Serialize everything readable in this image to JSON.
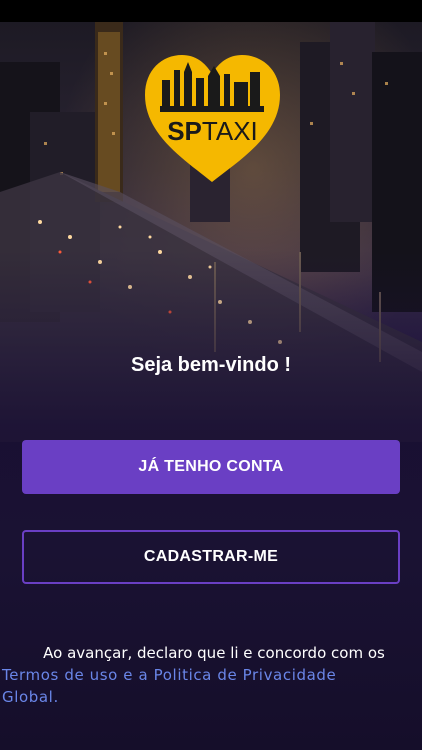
{
  "logo": {
    "text_sp": "SP",
    "text_taxi": "TAXI"
  },
  "welcome": "Seja bem-vindo !",
  "buttons": {
    "login": "JÁ TENHO CONTA",
    "signup": "CADASTRAR-ME"
  },
  "consent": {
    "text": "Ao avançar, declaro que li e concordo com os",
    "link_line1": "Termos de uso e a Politica de Privacidade",
    "link_line2": "Global."
  },
  "colors": {
    "accent": "#6a3fc4",
    "link": "#6a86e8",
    "logo_yellow": "#f5b800"
  }
}
